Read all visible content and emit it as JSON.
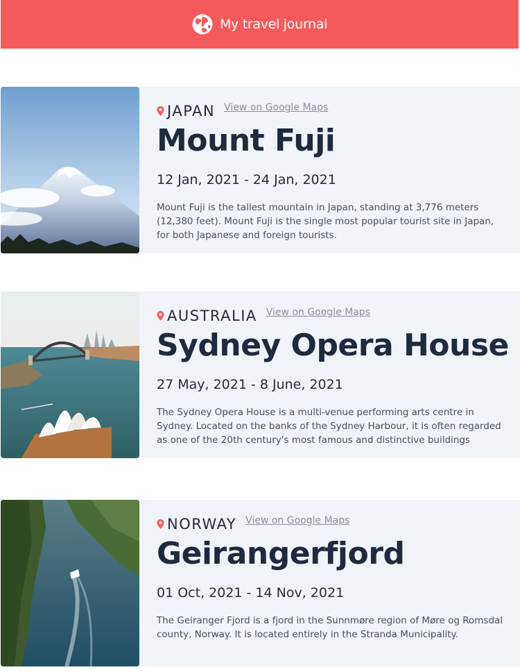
{
  "header": {
    "title": "My travel journal",
    "icon": "globe-icon",
    "background": "#F55A5A"
  },
  "entries": [
    {
      "country": "JAPAN",
      "maps_link": "View on Google Maps",
      "place": "Mount Fuji",
      "dates": "12 Jan, 2021 - 24 Jan, 2021",
      "description": "Mount Fuji is the tallest mountain in Japan, standing at 3,776 meters (12,380 feet). Mount Fuji is the single most popular tourist site in Japan, for both Japanese and foreign tourists."
    },
    {
      "country": "AUSTRALIA",
      "maps_link": "View on Google Maps",
      "place": "Sydney Opera House",
      "dates": "27 May, 2021 - 8 June, 2021",
      "description": "The Sydney Opera House is a multi-venue performing arts centre in Sydney. Located on the banks of the Sydney Harbour, it is often regarded as one of the 20th century's most famous and distinctive buildings"
    },
    {
      "country": "NORWAY",
      "maps_link": "View on Google Maps",
      "place": "Geirangerfjord",
      "dates": "01 Oct, 2021 - 14 Nov, 2021",
      "description": "The Geiranger Fjord is a fjord in the Sunnmøre region of Møre og Romsdal county, Norway. It is located entirely in the Stranda Municipality."
    }
  ],
  "colors": {
    "accent": "#F55A5A",
    "card_bg": "#F0F3F8",
    "title": "#1F2A3C",
    "link": "#918E9B"
  }
}
